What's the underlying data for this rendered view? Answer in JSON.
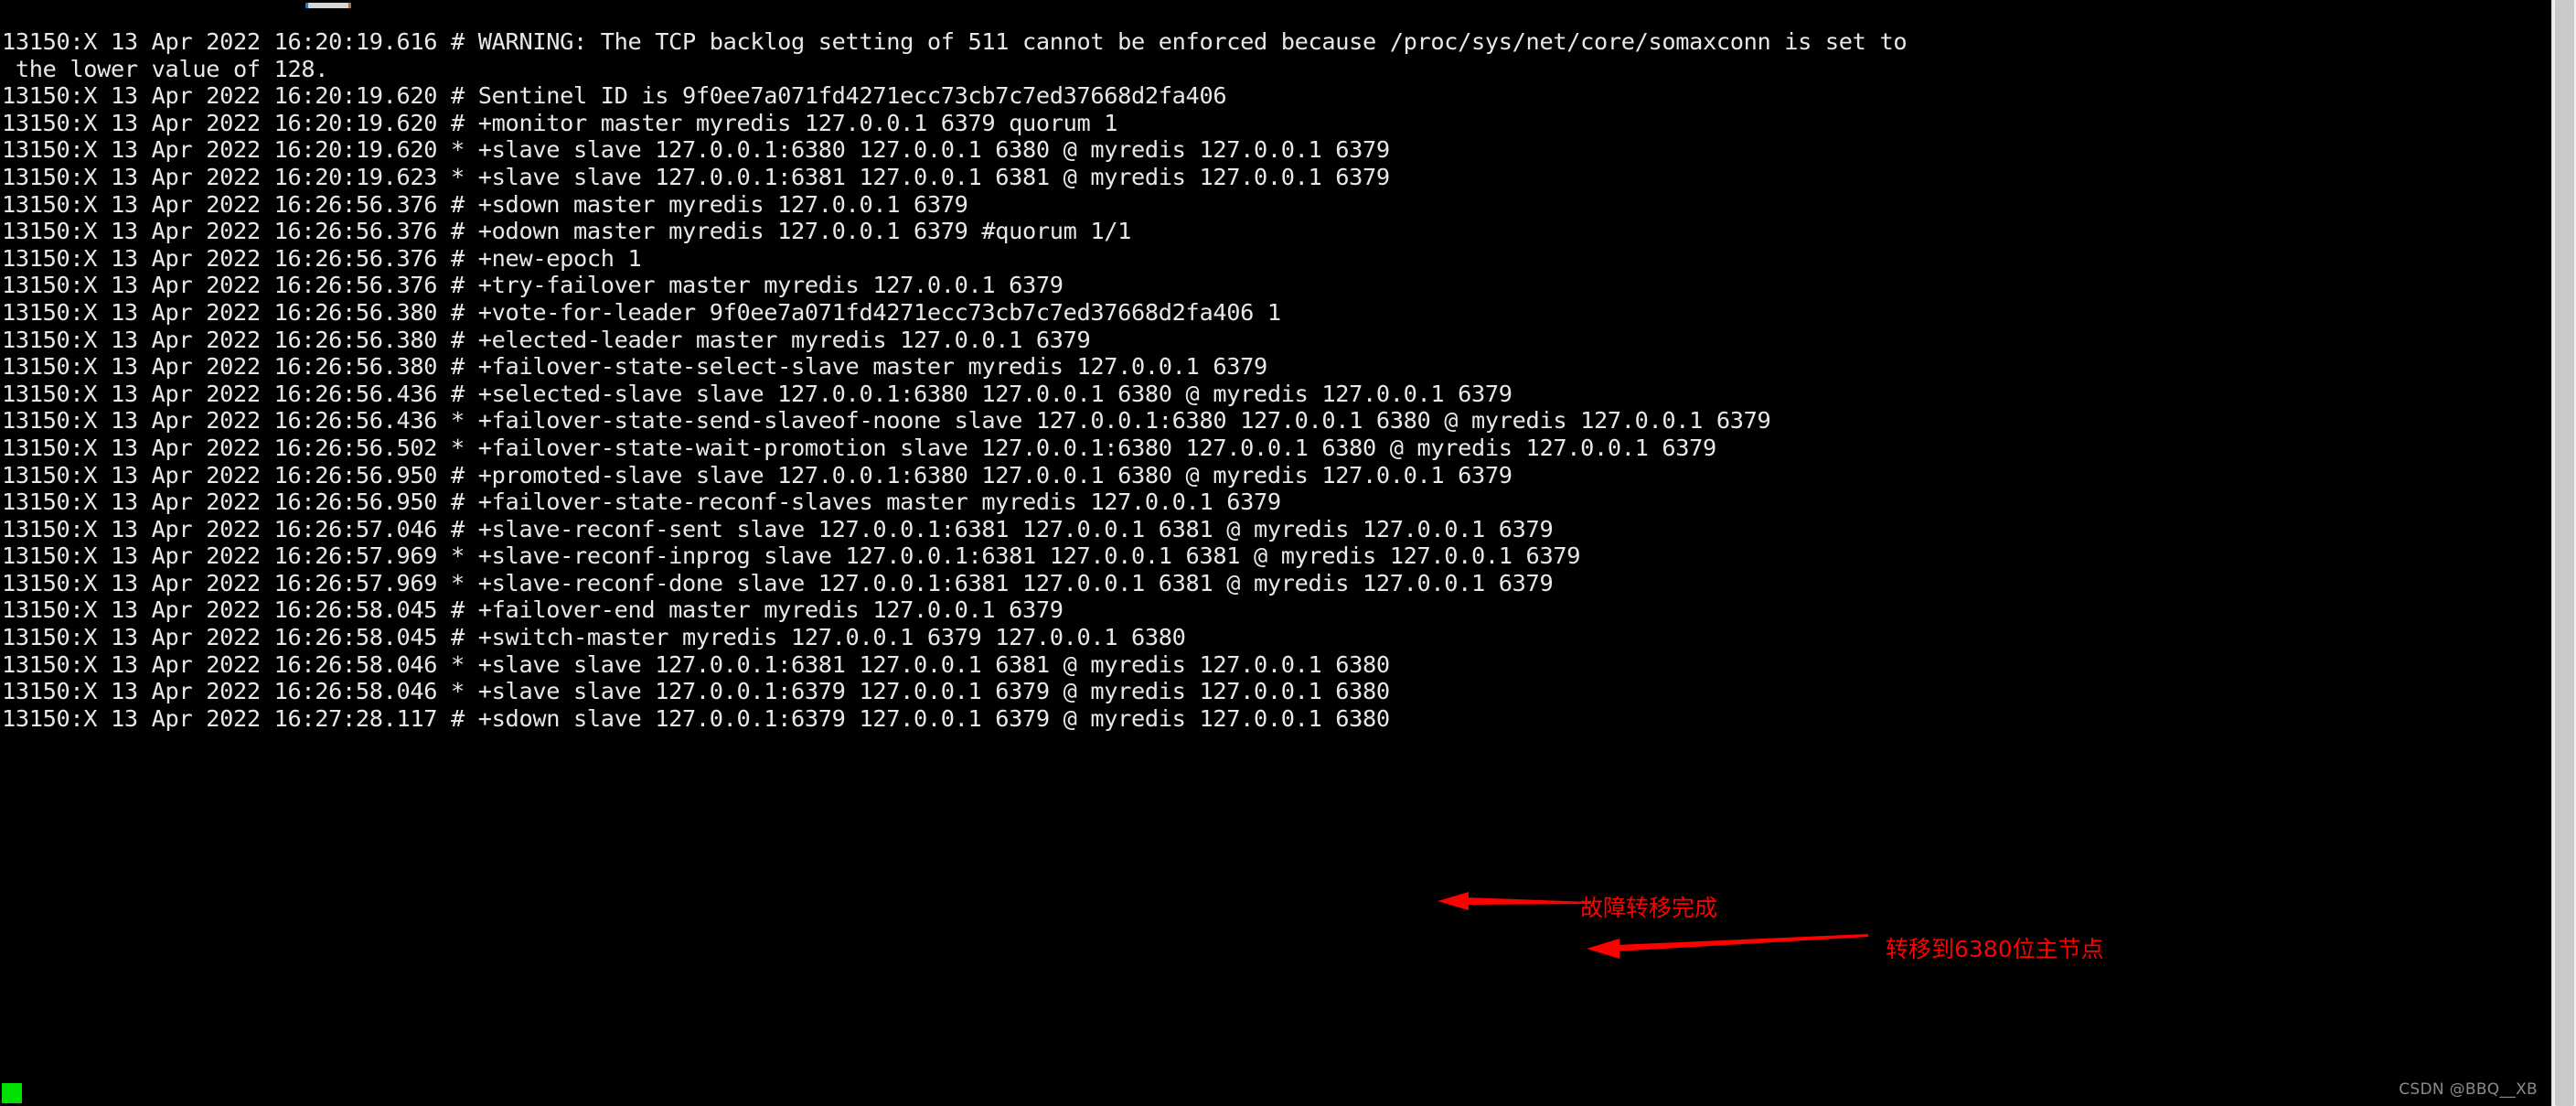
{
  "window": {
    "minimize_control": "minimize",
    "background_color": "#000000",
    "text_color": "#e8e8e8",
    "annotation_color": "#ff0000",
    "cursor_color": "#00e000"
  },
  "terminal": {
    "process_id": "13150:X",
    "lines": [
      "13150:X 13 Apr 2022 16:20:19.616 # WARNING: The TCP backlog setting of 511 cannot be enforced because /proc/sys/net/core/somaxconn is set to",
      " the lower value of 128.",
      "13150:X 13 Apr 2022 16:20:19.620 # Sentinel ID is 9f0ee7a071fd4271ecc73cb7c7ed37668d2fa406",
      "13150:X 13 Apr 2022 16:20:19.620 # +monitor master myredis 127.0.0.1 6379 quorum 1",
      "13150:X 13 Apr 2022 16:20:19.620 * +slave slave 127.0.0.1:6380 127.0.0.1 6380 @ myredis 127.0.0.1 6379",
      "13150:X 13 Apr 2022 16:20:19.623 * +slave slave 127.0.0.1:6381 127.0.0.1 6381 @ myredis 127.0.0.1 6379",
      "13150:X 13 Apr 2022 16:26:56.376 # +sdown master myredis 127.0.0.1 6379",
      "13150:X 13 Apr 2022 16:26:56.376 # +odown master myredis 127.0.0.1 6379 #quorum 1/1",
      "13150:X 13 Apr 2022 16:26:56.376 # +new-epoch 1",
      "13150:X 13 Apr 2022 16:26:56.376 # +try-failover master myredis 127.0.0.1 6379",
      "13150:X 13 Apr 2022 16:26:56.380 # +vote-for-leader 9f0ee7a071fd4271ecc73cb7c7ed37668d2fa406 1",
      "13150:X 13 Apr 2022 16:26:56.380 # +elected-leader master myredis 127.0.0.1 6379",
      "13150:X 13 Apr 2022 16:26:56.380 # +failover-state-select-slave master myredis 127.0.0.1 6379",
      "13150:X 13 Apr 2022 16:26:56.436 # +selected-slave slave 127.0.0.1:6380 127.0.0.1 6380 @ myredis 127.0.0.1 6379",
      "13150:X 13 Apr 2022 16:26:56.436 * +failover-state-send-slaveof-noone slave 127.0.0.1:6380 127.0.0.1 6380 @ myredis 127.0.0.1 6379",
      "13150:X 13 Apr 2022 16:26:56.502 * +failover-state-wait-promotion slave 127.0.0.1:6380 127.0.0.1 6380 @ myredis 127.0.0.1 6379",
      "13150:X 13 Apr 2022 16:26:56.950 # +promoted-slave slave 127.0.0.1:6380 127.0.0.1 6380 @ myredis 127.0.0.1 6379",
      "13150:X 13 Apr 2022 16:26:56.950 # +failover-state-reconf-slaves master myredis 127.0.0.1 6379",
      "13150:X 13 Apr 2022 16:26:57.046 # +slave-reconf-sent slave 127.0.0.1:6381 127.0.0.1 6381 @ myredis 127.0.0.1 6379",
      "13150:X 13 Apr 2022 16:26:57.969 * +slave-reconf-inprog slave 127.0.0.1:6381 127.0.0.1 6381 @ myredis 127.0.0.1 6379",
      "13150:X 13 Apr 2022 16:26:57.969 * +slave-reconf-done slave 127.0.0.1:6381 127.0.0.1 6381 @ myredis 127.0.0.1 6379",
      "13150:X 13 Apr 2022 16:26:58.045 # +failover-end master myredis 127.0.0.1 6379",
      "13150:X 13 Apr 2022 16:26:58.045 # +switch-master myredis 127.0.0.1 6379 127.0.0.1 6380",
      "13150:X 13 Apr 2022 16:26:58.046 * +slave slave 127.0.0.1:6381 127.0.0.1 6381 @ myredis 127.0.0.1 6380",
      "13150:X 13 Apr 2022 16:26:58.046 * +slave slave 127.0.0.1:6379 127.0.0.1 6379 @ myredis 127.0.0.1 6380",
      "13150:X 13 Apr 2022 16:27:28.117 # +sdown slave 127.0.0.1:6379 127.0.0.1 6379 @ myredis 127.0.0.1 6380"
    ]
  },
  "annotations": [
    {
      "id": "failover-complete",
      "label": "故障转移完成",
      "target_line": "+failover-end master myredis 127.0.0.1 6379"
    },
    {
      "id": "switch-to-6380",
      "label": "转移到6380位主节点",
      "target_line": "+switch-master myredis 127.0.0.1 6379 127.0.0.1 6380"
    }
  ],
  "watermark": {
    "text": "CSDN @BBQ__XB"
  }
}
